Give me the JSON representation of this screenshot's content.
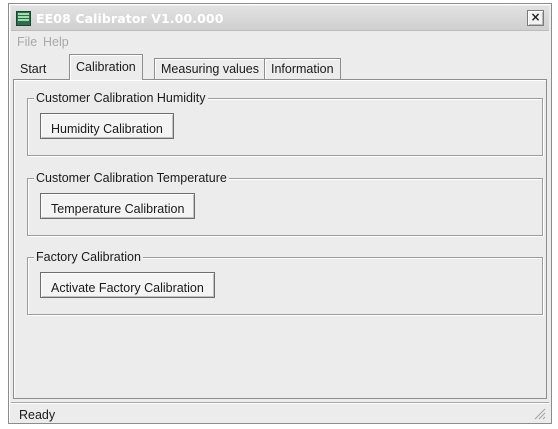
{
  "window": {
    "title": "EE08 Calibrator V1.00.000",
    "close_label": "×"
  },
  "menu": {
    "items": [
      "File",
      "Help"
    ]
  },
  "tabs": {
    "items": [
      {
        "label": "Start"
      },
      {
        "label": "Calibration",
        "active": true
      },
      {
        "label": "Measuring values"
      },
      {
        "label": "Information"
      }
    ]
  },
  "groups": [
    {
      "title": "Customer Calibration Humidity",
      "button": "Humidity Calibration"
    },
    {
      "title": "Customer Calibration Temperature",
      "button": "Temperature Calibration"
    },
    {
      "title": "Factory Calibration",
      "button": "Activate Factory Calibration"
    }
  ],
  "status": {
    "text": "Ready"
  },
  "icons": {
    "app": "ee08-app-icon",
    "close": "close-icon",
    "grip": "resize-grip-icon"
  },
  "colors": {
    "window_bg": "#ececec",
    "title_text": "#ffffff",
    "disabled_menu": "#a8a8a8"
  }
}
